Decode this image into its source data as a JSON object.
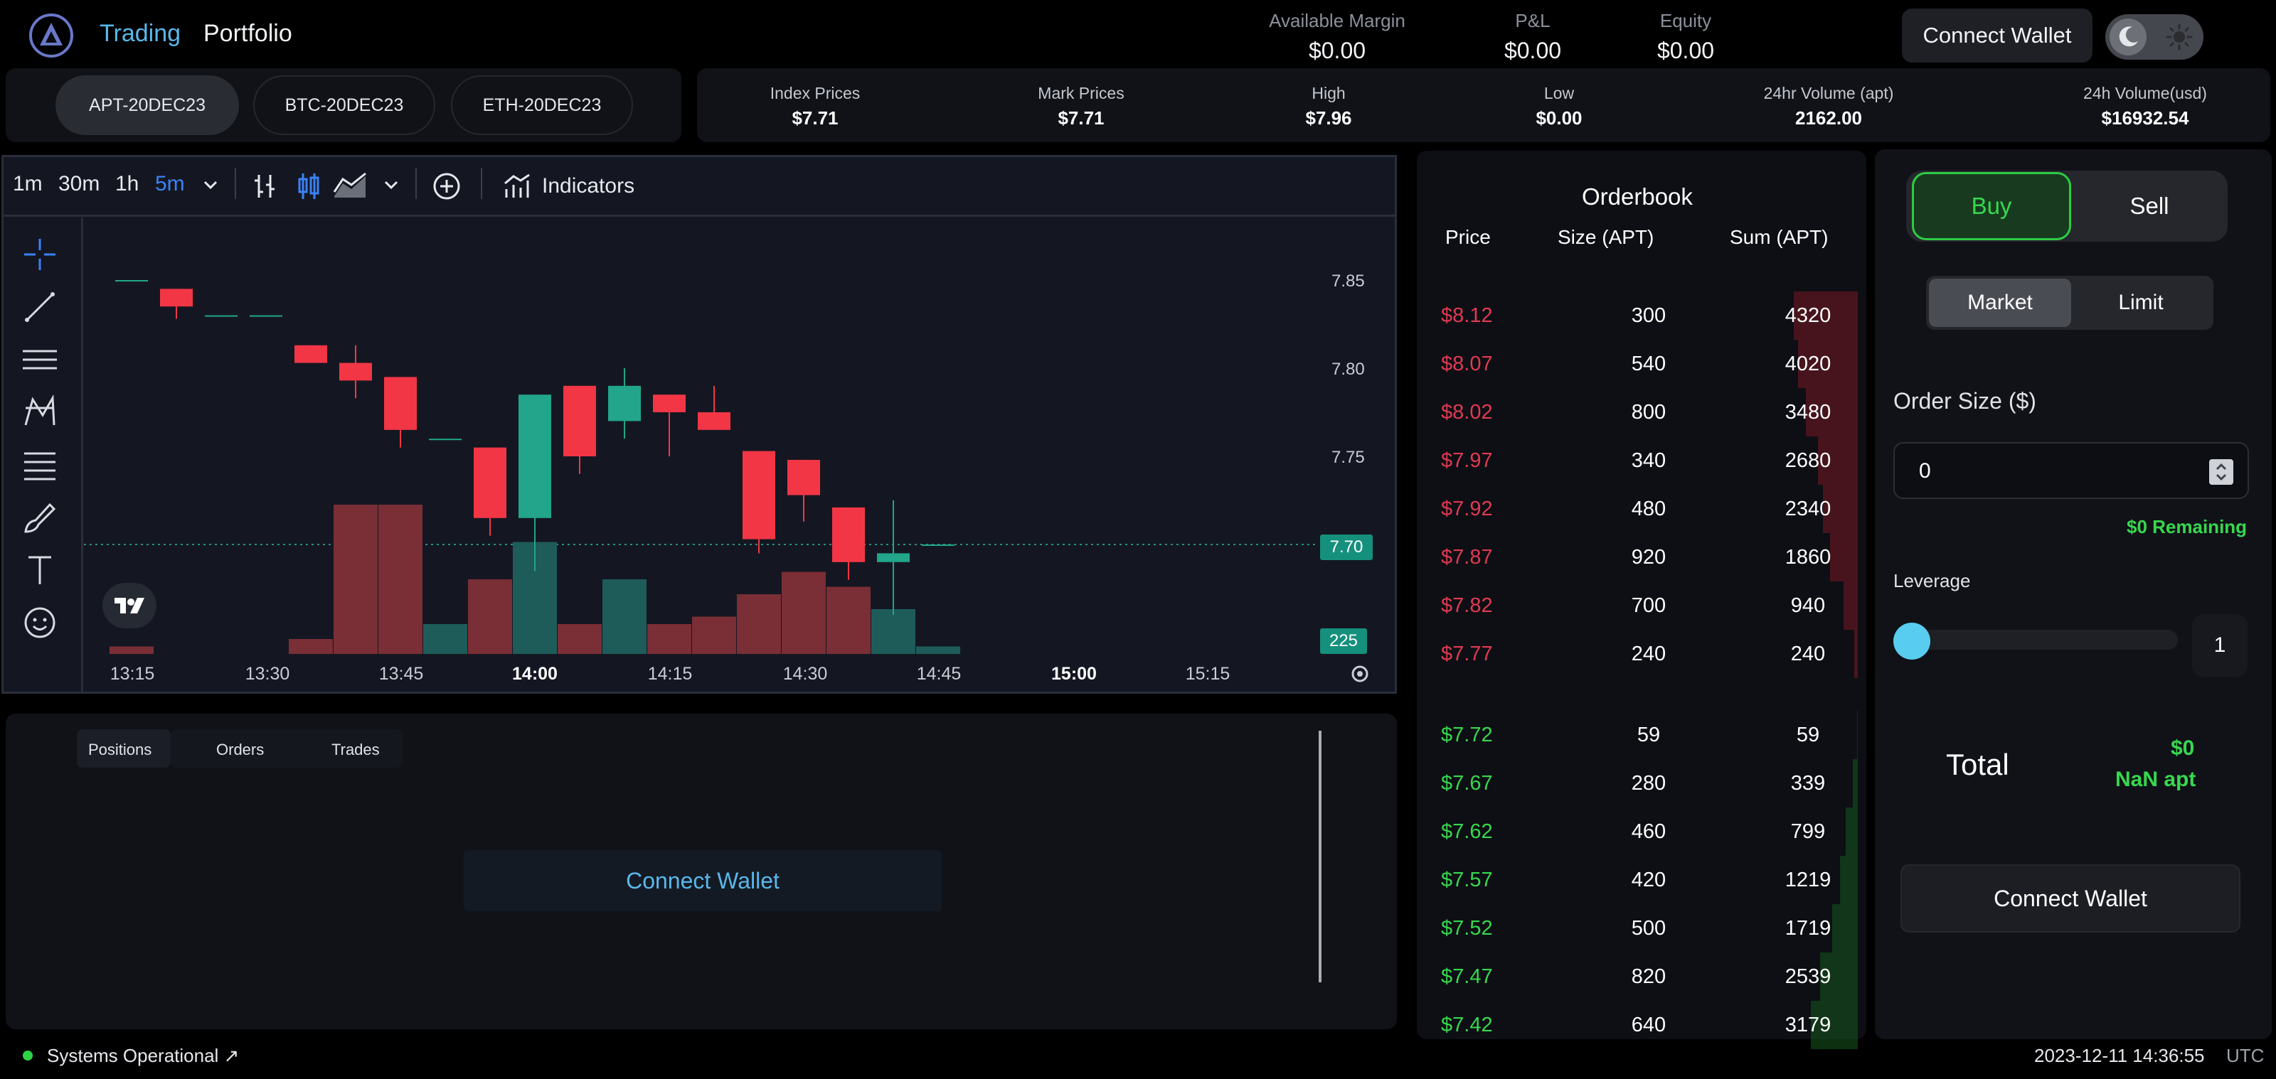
{
  "nav": {
    "trading": "Trading",
    "portfolio": "Portfolio"
  },
  "header_stats": [
    {
      "label": "Available Margin",
      "value": "$0.00"
    },
    {
      "label": "P&L",
      "value": "$0.00"
    },
    {
      "label": "Equity",
      "value": "$0.00"
    }
  ],
  "connect_wallet": "Connect Wallet",
  "markets": [
    "APT-20DEC23",
    "BTC-20DEC23",
    "ETH-20DEC23"
  ],
  "price_stats": [
    {
      "label": "Index Prices",
      "value": "$7.71"
    },
    {
      "label": "Mark Prices",
      "value": "$7.71"
    },
    {
      "label": "High",
      "value": "$7.96"
    },
    {
      "label": "Low",
      "value": "$0.00"
    },
    {
      "label": "24hr Volume (apt)",
      "value": "2162.00"
    },
    {
      "label": "24h Volume(usd)",
      "value": "$16932.54"
    }
  ],
  "chart_toolbar": {
    "intervals": [
      "1m",
      "30m",
      "1h",
      "5m"
    ],
    "active_interval": "5m",
    "indicators": "Indicators"
  },
  "chart_data": {
    "type": "candlestick",
    "y_ticks": [
      "7.85",
      "7.80",
      "7.75"
    ],
    "price_marker": "7.70",
    "volume_marker": "225",
    "x_ticks": [
      "13:15",
      "13:30",
      "13:45",
      "14:00",
      "14:15",
      "14:30",
      "14:45",
      "15:00",
      "15:15"
    ],
    "bold_x_ticks": [
      "14:00",
      "15:00"
    ],
    "candles": [
      {
        "o": 7.85,
        "h": 7.85,
        "l": 7.85,
        "c": 7.85
      },
      {
        "o": 7.845,
        "h": 7.845,
        "l": 7.828,
        "c": 7.835
      },
      {
        "o": 7.83,
        "h": 7.83,
        "l": 7.83,
        "c": 7.83
      },
      {
        "o": 7.83,
        "h": 7.83,
        "l": 7.83,
        "c": 7.83
      },
      {
        "o": 7.813,
        "h": 7.813,
        "l": 7.803,
        "c": 7.803
      },
      {
        "o": 7.803,
        "h": 7.813,
        "l": 7.783,
        "c": 7.793
      },
      {
        "o": 7.795,
        "h": 7.795,
        "l": 7.755,
        "c": 7.765
      },
      {
        "o": 7.76,
        "h": 7.76,
        "l": 7.76,
        "c": 7.76
      },
      {
        "o": 7.755,
        "h": 7.755,
        "l": 7.705,
        "c": 7.715
      },
      {
        "o": 7.715,
        "h": 7.785,
        "l": 7.685,
        "c": 7.785
      },
      {
        "o": 7.79,
        "h": 7.79,
        "l": 7.74,
        "c": 7.75
      },
      {
        "o": 7.77,
        "h": 7.8,
        "l": 7.76,
        "c": 7.79
      },
      {
        "o": 7.785,
        "h": 7.785,
        "l": 7.75,
        "c": 7.775
      },
      {
        "o": 7.775,
        "h": 7.79,
        "l": 7.765,
        "c": 7.765
      },
      {
        "o": 7.753,
        "h": 7.753,
        "l": 7.695,
        "c": 7.703
      },
      {
        "o": 7.748,
        "h": 7.748,
        "l": 7.713,
        "c": 7.728
      },
      {
        "o": 7.721,
        "h": 7.721,
        "l": 7.68,
        "c": 7.69
      },
      {
        "o": 7.69,
        "h": 7.725,
        "l": 7.66,
        "c": 7.695
      },
      {
        "o": 7.7,
        "h": 7.7,
        "l": 7.7,
        "c": 7.7
      }
    ],
    "volumes": [
      10,
      0,
      0,
      0,
      20,
      200,
      200,
      40,
      100,
      150,
      40,
      100,
      40,
      50,
      80,
      110,
      90,
      60,
      10
    ],
    "volume_up": [
      false,
      false,
      false,
      false,
      false,
      false,
      false,
      true,
      false,
      true,
      false,
      true,
      false,
      false,
      false,
      false,
      false,
      true,
      true
    ]
  },
  "bottom_tabs": [
    "Positions",
    "Orders",
    "Trades"
  ],
  "orderbook": {
    "title": "Orderbook",
    "headers": [
      "Price",
      "Size (APT)",
      "Sum (APT)"
    ],
    "asks": [
      {
        "price": "$8.12",
        "size": "300",
        "sum": "4320"
      },
      {
        "price": "$8.07",
        "size": "540",
        "sum": "4020"
      },
      {
        "price": "$8.02",
        "size": "800",
        "sum": "3480"
      },
      {
        "price": "$7.97",
        "size": "340",
        "sum": "2680"
      },
      {
        "price": "$7.92",
        "size": "480",
        "sum": "2340"
      },
      {
        "price": "$7.87",
        "size": "920",
        "sum": "1860"
      },
      {
        "price": "$7.82",
        "size": "700",
        "sum": "940"
      },
      {
        "price": "$7.77",
        "size": "240",
        "sum": "240"
      }
    ],
    "bids": [
      {
        "price": "$7.72",
        "size": "59",
        "sum": "59"
      },
      {
        "price": "$7.67",
        "size": "280",
        "sum": "339"
      },
      {
        "price": "$7.62",
        "size": "460",
        "sum": "799"
      },
      {
        "price": "$7.57",
        "size": "420",
        "sum": "1219"
      },
      {
        "price": "$7.52",
        "size": "500",
        "sum": "1719"
      },
      {
        "price": "$7.47",
        "size": "820",
        "sum": "2539"
      },
      {
        "price": "$7.42",
        "size": "640",
        "sum": "3179"
      }
    ],
    "max_sum": 4320
  },
  "order_form": {
    "buy": "Buy",
    "sell": "Sell",
    "market": "Market",
    "limit": "Limit",
    "order_size_label": "Order Size ($)",
    "order_size_value": "0",
    "remaining": "$0 Remaining",
    "leverage_label": "Leverage",
    "leverage_value": "1",
    "total_label": "Total",
    "total_usd": "$0",
    "total_apt": "NaN apt"
  },
  "footer": {
    "status": "Systems Operational ↗",
    "datetime": "2023-12-11 14:36:55",
    "tz": "UTC"
  },
  "colors": {
    "accent": "#5ab7ea",
    "buy": "#37d84e",
    "ask": "#e03a52",
    "up": "#22a58a",
    "down": "#f23645"
  }
}
